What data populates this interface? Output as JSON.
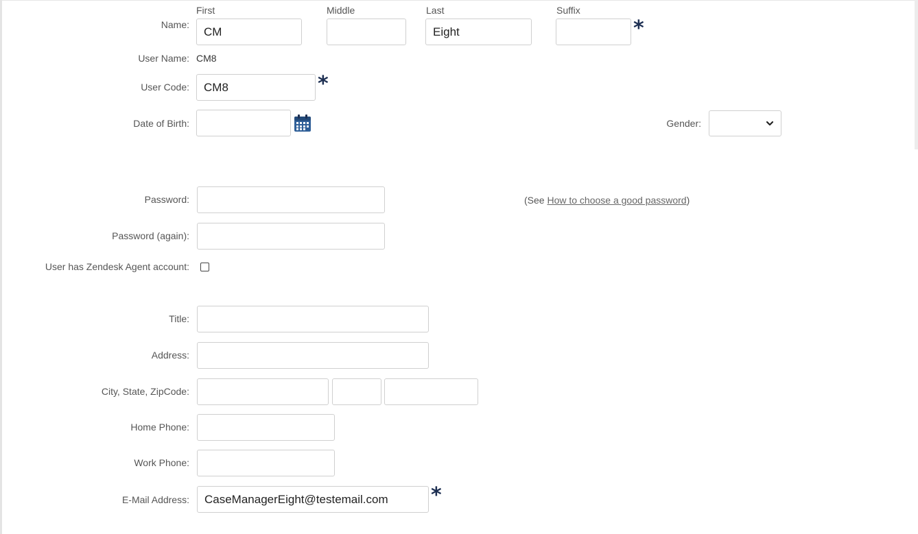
{
  "name": {
    "label": "Name:",
    "first_label": "First",
    "middle_label": "Middle",
    "last_label": "Last",
    "suffix_label": "Suffix",
    "first_value": "CM",
    "middle_value": "",
    "last_value": "Eight",
    "suffix_value": ""
  },
  "user_name": {
    "label": "User Name:",
    "value": "CM8"
  },
  "user_code": {
    "label": "User Code:",
    "value": "CM8"
  },
  "dob": {
    "label": "Date of Birth:",
    "value": ""
  },
  "gender": {
    "label": "Gender:",
    "value": ""
  },
  "required_mark": "*",
  "password": {
    "label": "Password:",
    "value": "",
    "hint_prefix": "(See ",
    "hint_link": "How to choose a good password",
    "hint_suffix": ")"
  },
  "password_again": {
    "label": "Password (again):",
    "value": ""
  },
  "zendesk": {
    "label": "User has Zendesk Agent account:",
    "checked": false
  },
  "title": {
    "label": "Title:",
    "value": ""
  },
  "address": {
    "label": "Address:",
    "value": ""
  },
  "city_state_zip": {
    "label": "City, State, ZipCode:",
    "city": "",
    "state": "",
    "zip": ""
  },
  "home_phone": {
    "label": "Home Phone:",
    "value": ""
  },
  "work_phone": {
    "label": "Work Phone:",
    "value": ""
  },
  "email": {
    "label": "E-Mail Address:",
    "value": "CaseManagerEight@testemail.com"
  },
  "icons": {
    "calendar": "calendar-icon",
    "chevron": "chevron-down-icon",
    "required": "asterisk-icon"
  },
  "colors": {
    "required_star": "#1d2f52",
    "calendar": "#2f5f98",
    "border": "#cfcfcf"
  }
}
